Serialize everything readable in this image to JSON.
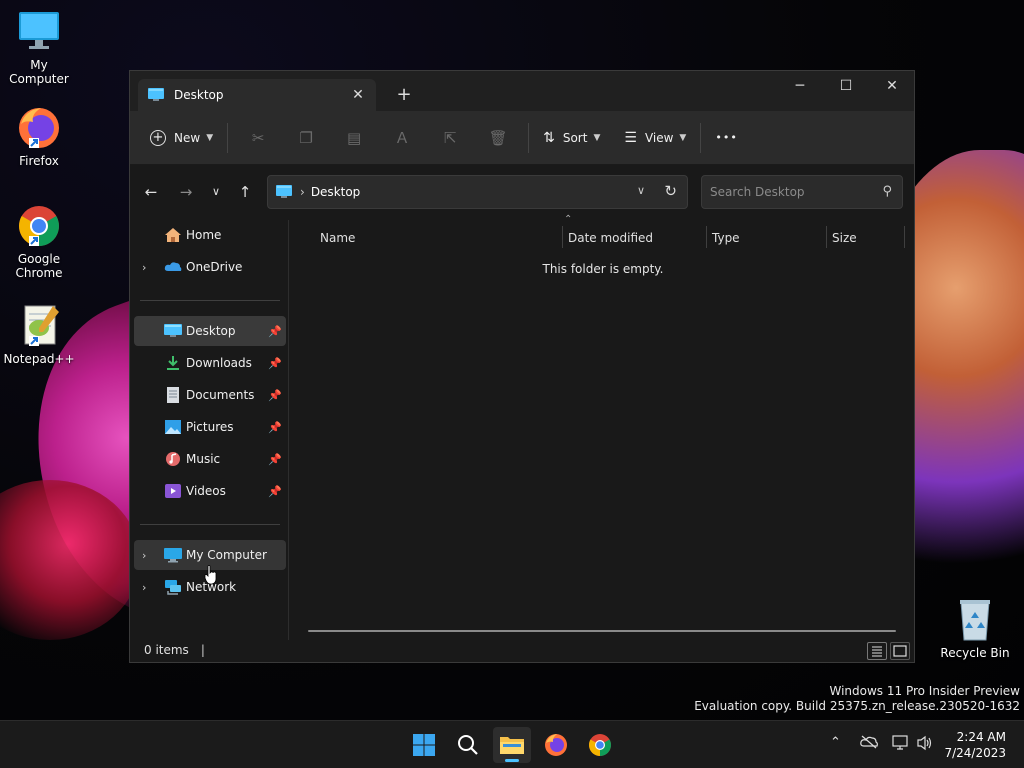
{
  "desktop": {
    "icons": [
      {
        "label": "My Computer"
      },
      {
        "label": "Firefox"
      },
      {
        "label": "Google Chrome"
      },
      {
        "label": "Notepad++"
      },
      {
        "label": "Recycle Bin"
      }
    ]
  },
  "window": {
    "tab_title": "Desktop",
    "new_tab_symbol": "+",
    "controls": {
      "minimize": "─",
      "maximize": "☐",
      "close": "✕"
    }
  },
  "command_bar": {
    "new_label": "New",
    "sort_label": "Sort",
    "view_label": "View",
    "more_label": "•••"
  },
  "navigation": {
    "address_path": "Desktop",
    "search_placeholder": "Search Desktop"
  },
  "sidebar": {
    "items": [
      {
        "label": "Home",
        "icon": "home-icon"
      },
      {
        "label": "OneDrive",
        "icon": "cloud-icon"
      },
      {
        "label": "Desktop",
        "icon": "desktop-icon",
        "pinned": true
      },
      {
        "label": "Downloads",
        "icon": "download-icon",
        "pinned": true
      },
      {
        "label": "Documents",
        "icon": "document-icon",
        "pinned": true
      },
      {
        "label": "Pictures",
        "icon": "picture-icon",
        "pinned": true
      },
      {
        "label": "Music",
        "icon": "music-icon",
        "pinned": true
      },
      {
        "label": "Videos",
        "icon": "video-icon",
        "pinned": true
      },
      {
        "label": "My Computer",
        "icon": "computer-icon"
      },
      {
        "label": "Network",
        "icon": "network-icon"
      }
    ]
  },
  "content": {
    "columns": [
      "Name",
      "Date modified",
      "Type",
      "Size"
    ],
    "empty_message": "This folder is empty."
  },
  "status": {
    "item_count": "0 items"
  },
  "taskbar": {
    "time": "2:24 AM",
    "date": "7/24/2023"
  },
  "watermark": {
    "line1": "Windows 11 Pro Insider Preview",
    "line2": "Evaluation copy. Build 25375.zn_release.230520-1632"
  },
  "colors": {
    "accent": "#4cc2ff",
    "window_bg": "#191919",
    "toolbar_bg": "#2b2b2b"
  }
}
